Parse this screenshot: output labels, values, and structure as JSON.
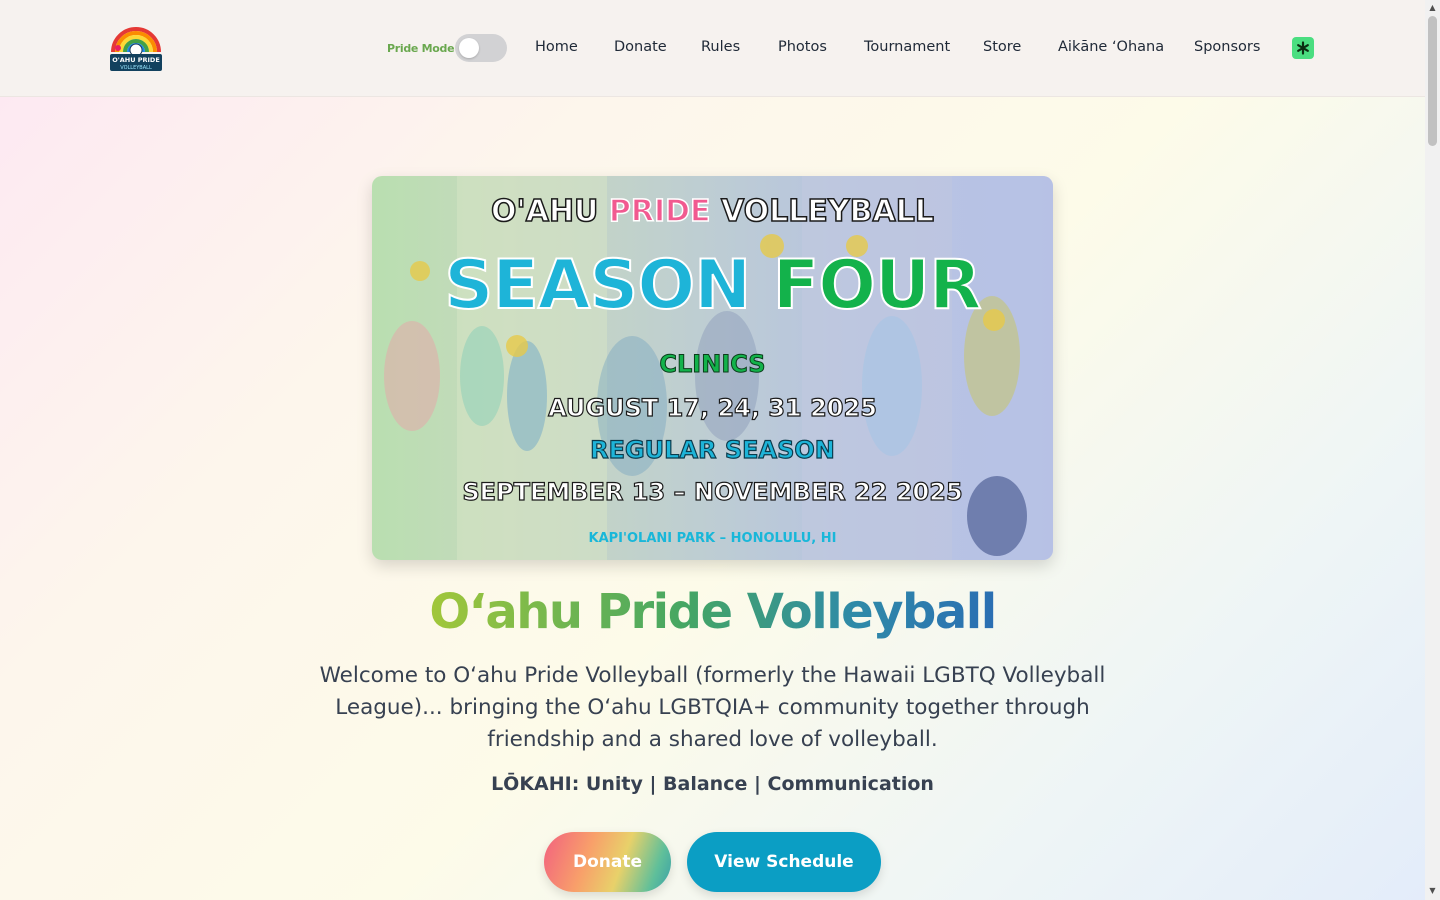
{
  "navbar": {
    "logo_text_top": "O'AHU PRIDE",
    "logo_text_bottom": "VOLLEYBALL",
    "pride_mode_label": "Pride Mode",
    "pride_mode_on": false,
    "links": [
      "Home",
      "Donate",
      "Rules",
      "Photos",
      "Tournament",
      "Store",
      "Aikāne ʻOhana",
      "Sponsors"
    ],
    "extension_icon": "asterisk-icon"
  },
  "poster": {
    "line1_a": "O'AHU ",
    "line1_pride": "PRIDE",
    "line1_b": " VOLLEYBALL",
    "season": "SEASON",
    "four": "FOUR",
    "clinics": "CLINICS",
    "clinic_dates": "AUGUST 17, 24, 31 2025",
    "regular_season": "REGULAR SEASON",
    "season_dates": "SEPTEMBER 13 – NOVEMBER 22 2025",
    "location": "KAPI'OLANI PARK – HONOLULU, HI"
  },
  "hero": {
    "title": "Oʻahu Pride Volleyball",
    "welcome": "Welcome to Oʻahu Pride Volleyball (formerly the Hawaii LGBTQ Volleyball League)... bringing the Oʻahu LGBTQIA+ community together through friendship and a shared love of volleyball.",
    "lokahi": "LŌKAHI: Unity | Balance | Communication",
    "donate_button": "Donate",
    "schedule_button": "View Schedule"
  },
  "colors": {
    "navbar_bg": "#f6f2ef",
    "schedule_button": "#0b9ec4",
    "pride_label": "#6aa84f",
    "extension_icon_bg": "#4ade80"
  }
}
